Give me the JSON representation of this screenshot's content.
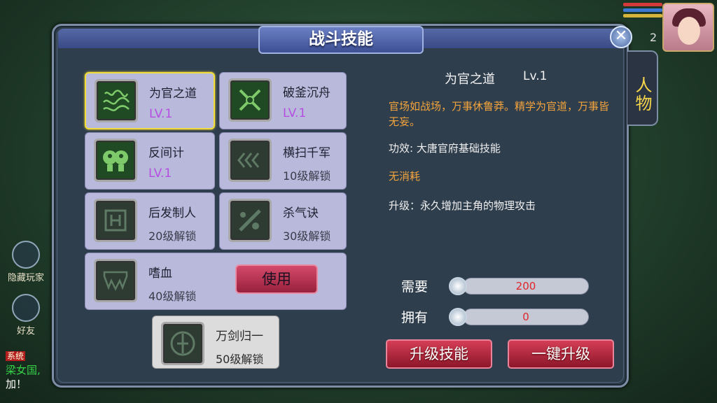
{
  "window": {
    "title": "战斗技能",
    "close_icon": "close-icon",
    "side_tab": "人物"
  },
  "hud": {
    "player_level_hint": "2"
  },
  "background": {
    "left_buttons": [
      {
        "label": "隐藏玩家",
        "icon": "hide-players-icon"
      },
      {
        "label": "好友",
        "icon": "handshake-icon"
      }
    ],
    "chat": {
      "system_tag": "系统",
      "line1": "梁女国,",
      "line2": "加！"
    }
  },
  "skills": [
    {
      "name": "为官之道",
      "level": "LV.1",
      "icon": "official-way-icon",
      "locked": false
    },
    {
      "name": "破釜沉舟",
      "level": "LV.1",
      "icon": "crossed-swords-icon",
      "locked": false
    },
    {
      "name": "反间计",
      "level": "LV.1",
      "icon": "masks-icon",
      "locked": false
    },
    {
      "name": "横扫千军",
      "unlock": "10级解锁",
      "icon": "arrows-icon",
      "locked": true
    },
    {
      "name": "后发制人",
      "unlock": "20级解锁",
      "icon": "counter-icon",
      "locked": true
    },
    {
      "name": "杀气诀",
      "unlock": "30级解锁",
      "icon": "blade-icon",
      "locked": true
    },
    {
      "name": "嗜血",
      "unlock": "40级解锁",
      "icon": "fangs-icon",
      "locked": true
    },
    {
      "name": "万剑归一",
      "unlock": "50级解锁",
      "icon": "sword-circle-icon",
      "locked": true
    }
  ],
  "use_button": "使用",
  "detail": {
    "name": "为官之道",
    "level": "Lv.1",
    "description": "官场如战场，万事休鲁莽。精学为官道，万事皆无妄。",
    "effect": "功效: 大唐官府基础技能",
    "cost": "无消耗",
    "upgrade": "升级：永久增加主角的物理攻击"
  },
  "resources": [
    {
      "label": "需要",
      "value": "200",
      "icon": "silver-coin-icon"
    },
    {
      "label": "拥有",
      "value": "0",
      "icon": "silver-coin-icon"
    }
  ],
  "buttons": {
    "upgrade": "升级技能",
    "one_click": "一键升级"
  },
  "colors": {
    "selected_border": "#f2dc3a",
    "level_text": "#b44fe0",
    "desc_text": "#f3a43c",
    "action_button": "#b3283f"
  }
}
